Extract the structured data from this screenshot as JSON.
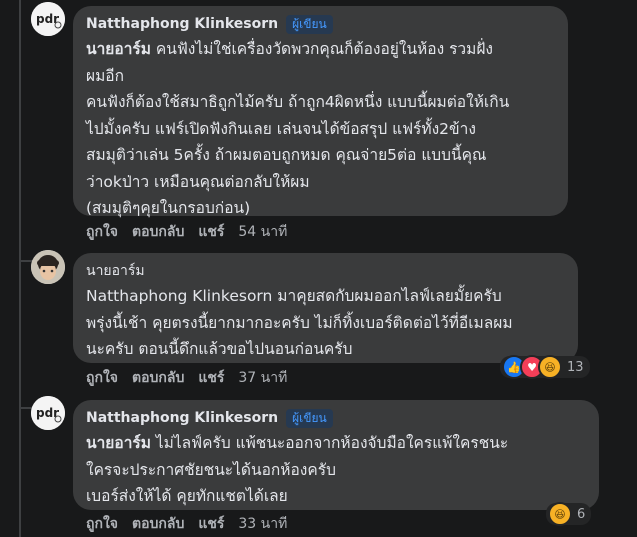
{
  "comments": [
    {
      "author": "Natthaphong Klinkesorn",
      "badge": "ผู้เขียน",
      "mention": "นายอาร์ม",
      "lines": [
        " คนฟังไม่ใช่เครื่องวัดพวกคุณก็ต้องอยู่ในห้อง รวมฝั่ง",
        "ผมอีก",
        "คนฟังก็ต้องใช้สมาธิถูกไม้ครับ ถ้าถูก4ผิดหนึ่ง แบบนี้ผมต่อให้เกิน",
        "ไปมั้งครับ แฟร์เปิดฟังกินเลย เล่นจนได้ข้อสรุป แฟร์ทั้ง2ข้าง",
        "สมมุติว่าเล่น 5ครั้ง ถ้าผมตอบถูกหมด คุณจ่าย5ต่อ แบบนี้คุณ",
        "ว่าokป่าว เหมือนคุณต่อกลับให้ผม",
        "(สมมุติๆคุยในกรอบก่อน)"
      ],
      "actions": {
        "like": "ถูกใจ",
        "reply": "ตอบกลับ",
        "share": "แชร์",
        "time": "54 นาที"
      }
    },
    {
      "author": "นายอาร์ม",
      "lines": [
        "Natthaphong Klinkesorn มาคุยสดกับผมออกไลฟ์เลยมั้ยครับ",
        "พรุ่งนี้เช้า คุยตรงนี้ยากมากอะครับ ไม่ก็ทิ้งเบอร์ติดต่อไว้ที่อีเมลผม",
        "นะครับ ตอนนี้ดึกแล้วขอไปนอนก่อนครับ"
      ],
      "actions": {
        "like": "ถูกใจ",
        "reply": "ตอบกลับ",
        "share": "แชร์",
        "time": "37 นาที"
      },
      "reactions": {
        "icons": [
          "like-icon",
          "love-icon",
          "haha-icon"
        ],
        "count": "13"
      }
    },
    {
      "author": "Natthaphong Klinkesorn",
      "badge": "ผู้เขียน",
      "mention": "นายอาร์ม",
      "lines": [
        " ไม่ไลฟ์ครับ แพ้ชนะออกจากห้องจับมือใครแพ้ใครชนะ",
        "ใครจะประกาศชัยชนะได้นอกห้องครับ",
        "เบอร์ส่งให้ได้ คุยทักแชตได้เลย"
      ],
      "actions": {
        "like": "ถูกใจ",
        "reply": "ตอบกลับ",
        "share": "แชร์",
        "time": "33 นาที"
      },
      "reactions": {
        "icons": [
          "haha-icon"
        ],
        "count": "6"
      }
    }
  ],
  "colors": {
    "background": "#18191a",
    "bubble": "#3a3b3c",
    "badge_text": "#4599ff",
    "muted": "#b0b3b8"
  }
}
